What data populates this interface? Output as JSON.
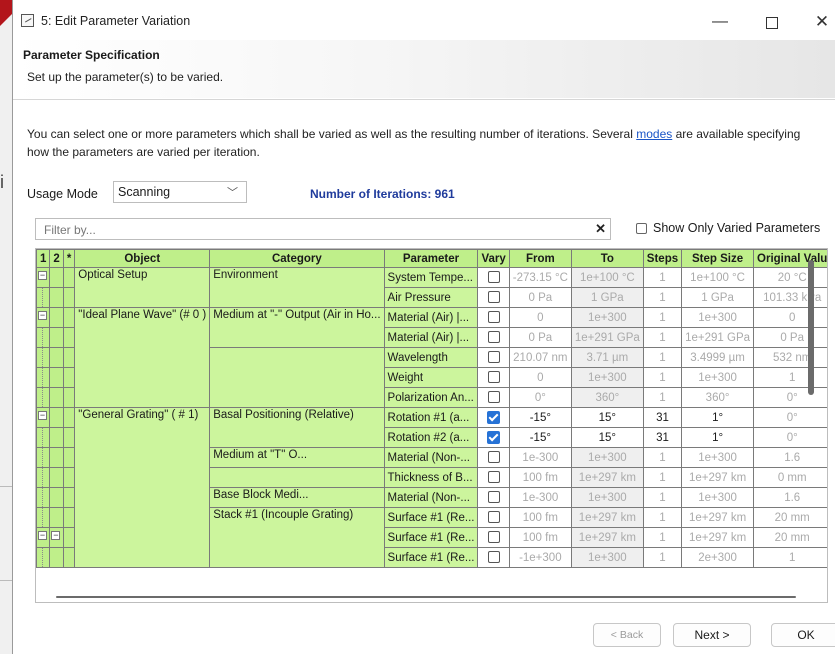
{
  "window": {
    "title": "5: Edit Parameter Variation"
  },
  "header": {
    "title": "Parameter Specification",
    "subtitle": "Set up the parameter(s) to be varied."
  },
  "description": {
    "before": "You can select one or more parameters which shall be varied as well as the resulting number of iterations. Several ",
    "link": "modes",
    "after": " are available specifying how the parameters are varied per iteration."
  },
  "usage": {
    "label": "Usage Mode",
    "value": "Scanning"
  },
  "iterations": "Number of Iterations: 961",
  "filter": {
    "placeholder": "Filter by..."
  },
  "show_only": "Show Only Varied Parameters",
  "table": {
    "headers": {
      "c1": "1",
      "c2": "2",
      "star": "*",
      "object": "Object",
      "category": "Category",
      "parameter": "Parameter",
      "vary": "Vary",
      "from": "From",
      "to": "To",
      "steps": "Steps",
      "step_size": "Step Size",
      "original": "Original Valu"
    },
    "objects": [
      "Optical Setup",
      "\"Ideal Plane Wave\" (# 0 )",
      "\"General Grating\" ( # 1)"
    ],
    "categories": [
      "Environment",
      "Medium at \"-\" Output (Air in Ho...",
      "Basal Positioning (Relative)",
      "Medium at \"T\" O...",
      "Base Block Medi...",
      "Stack #1 (Incouple Grating)"
    ],
    "rows": [
      {
        "param": "System Tempe...",
        "checked": false,
        "from": "-273.15 °C",
        "to": "1e+100 °C",
        "steps": "1",
        "step": "1e+100 °C",
        "orig": "20 °C"
      },
      {
        "param": "Air Pressure",
        "checked": false,
        "from": "0 Pa",
        "to": "1 GPa",
        "steps": "1",
        "step": "1 GPa",
        "orig": "101.33 kPa"
      },
      {
        "param": "Material (Air) |...",
        "checked": false,
        "from": "0",
        "to": "1e+300",
        "steps": "1",
        "step": "1e+300",
        "orig": "0"
      },
      {
        "param": "Material (Air) |...",
        "checked": false,
        "from": "0 Pa",
        "to": "1e+291 GPa",
        "steps": "1",
        "step": "1e+291 GPa",
        "orig": "0 Pa"
      },
      {
        "param": "Wavelength",
        "checked": false,
        "from": "210.07 nm",
        "to": "3.71 µm",
        "steps": "1",
        "step": "3.4999 µm",
        "orig": "532 nm"
      },
      {
        "param": "Weight",
        "checked": false,
        "from": "0",
        "to": "1e+300",
        "steps": "1",
        "step": "1e+300",
        "orig": "1"
      },
      {
        "param": "Polarization An...",
        "checked": false,
        "from": "0°",
        "to": "360°",
        "steps": "1",
        "step": "360°",
        "orig": "0°"
      },
      {
        "param": "Rotation #1 (a...",
        "checked": true,
        "from": "-15°",
        "to": "15°",
        "steps": "31",
        "step": "1°",
        "orig": "0°"
      },
      {
        "param": "Rotation #2 (a...",
        "checked": true,
        "from": "-15°",
        "to": "15°",
        "steps": "31",
        "step": "1°",
        "orig": "0°"
      },
      {
        "param": "Material (Non-...",
        "checked": false,
        "from": "1e-300",
        "to": "1e+300",
        "steps": "1",
        "step": "1e+300",
        "orig": "1.6"
      },
      {
        "param": "Thickness of B...",
        "checked": false,
        "from": "100 fm",
        "to": "1e+297 km",
        "steps": "1",
        "step": "1e+297 km",
        "orig": "0 mm"
      },
      {
        "param": "Material (Non-...",
        "checked": false,
        "from": "1e-300",
        "to": "1e+300",
        "steps": "1",
        "step": "1e+300",
        "orig": "1.6"
      },
      {
        "param": "Surface #1 (Re...",
        "checked": false,
        "from": "100 fm",
        "to": "1e+297 km",
        "steps": "1",
        "step": "1e+297 km",
        "orig": "20 mm"
      },
      {
        "param": "Surface #1 (Re...",
        "checked": false,
        "from": "100 fm",
        "to": "1e+297 km",
        "steps": "1",
        "step": "1e+297 km",
        "orig": "20 mm"
      },
      {
        "param": "Surface #1 (Re...",
        "checked": false,
        "from": "-1e+300",
        "to": "1e+300",
        "steps": "1",
        "step": "2e+300",
        "orig": "1"
      }
    ]
  },
  "buttons": {
    "back": "< Back",
    "next": "Next >",
    "ok": "OK"
  }
}
